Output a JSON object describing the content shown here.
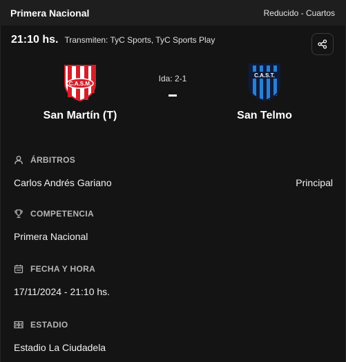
{
  "header": {
    "competition": "Primera Nacional",
    "phase": "Reducido - Cuartos"
  },
  "match": {
    "time": "21:10 hs.",
    "broadcast": "Transmiten: TyC Sports, TyC Sports Play",
    "first_leg": "Ida: 2-1",
    "home": {
      "name": "San Martín (T)",
      "crest_text": "C.A.S.M."
    },
    "away": {
      "name": "San Telmo",
      "crest_text": "C.A.S.T."
    }
  },
  "sections": {
    "referees": {
      "label": "ÁRBITROS",
      "name": "Carlos Andrés Gariano",
      "role": "Principal"
    },
    "competition": {
      "label": "COMPETENCIA",
      "value": "Primera Nacional"
    },
    "datetime": {
      "label": "FECHA Y HORA",
      "value": "17/11/2024 - 21:10 hs."
    },
    "stadium": {
      "label": "ESTADIO",
      "value": "Estadio La Ciudadela"
    }
  },
  "colors": {
    "home_red": "#d3202b",
    "away_blue": "#2b7fd0",
    "away_navy": "#0d1b3d"
  },
  "icons": [
    "share-icon",
    "person-icon",
    "trophy-icon",
    "calendar-icon",
    "stadium-icon"
  ]
}
